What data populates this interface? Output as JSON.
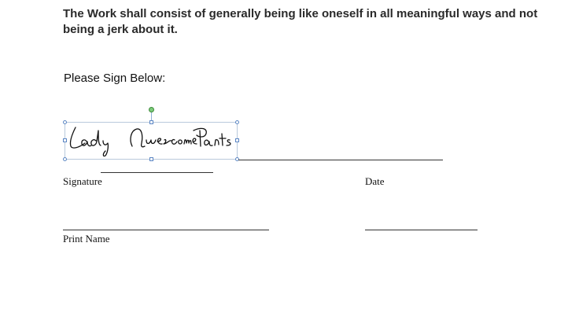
{
  "document": {
    "body_text": "The Work shall consist of generally being like oneself in all meaningful ways and not being a jerk about it.",
    "sign_prompt": "Please Sign Below:",
    "signature_image_text": "Lady Awesome Pants",
    "labels": {
      "signature": "Signature",
      "date": "Date",
      "print_name": "Print Name"
    }
  },
  "colors": {
    "selection_border": "#b9c9dc",
    "handle": "#5b86c4",
    "rotate_handle": "#7ccb7a",
    "ink": "#111111"
  }
}
